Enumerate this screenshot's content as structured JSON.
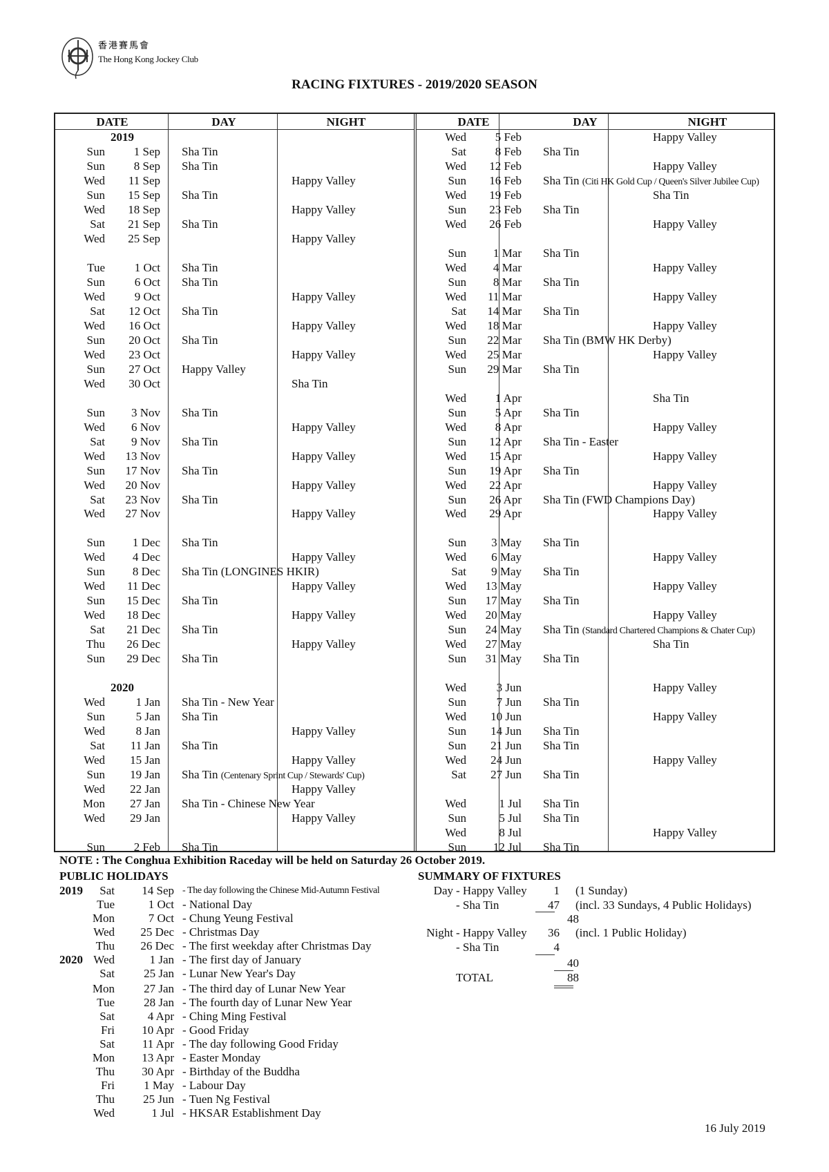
{
  "header": {
    "org_name_cn": "香港賽馬會",
    "org_name_en": "The Hong Kong Jockey Club",
    "logo_icon": "hkjc-crest-icon",
    "title": "RACING FIXTURES - 2019/2020 SEASON"
  },
  "table": {
    "columns": [
      "DATE",
      "DAY",
      "NIGHT",
      "DATE",
      "DAY",
      "NIGHT"
    ],
    "left": [
      {
        "year": "2019"
      },
      {
        "wd": "Sun",
        "date": "1 Sep",
        "day": "Sha Tin"
      },
      {
        "wd": "Sun",
        "date": "8 Sep",
        "day": "Sha Tin"
      },
      {
        "wd": "Wed",
        "date": "11 Sep",
        "night": "Happy Valley"
      },
      {
        "wd": "Sun",
        "date": "15 Sep",
        "day": "Sha Tin"
      },
      {
        "wd": "Wed",
        "date": "18 Sep",
        "night": "Happy Valley"
      },
      {
        "wd": "Sat",
        "date": "21 Sep",
        "day": "Sha Tin"
      },
      {
        "wd": "Wed",
        "date": "25 Sep",
        "night": "Happy Valley"
      },
      {},
      {
        "wd": "Tue",
        "date": "1 Oct",
        "day": "Sha Tin"
      },
      {
        "wd": "Sun",
        "date": "6 Oct",
        "day": "Sha Tin"
      },
      {
        "wd": "Wed",
        "date": "9 Oct",
        "night": "Happy Valley"
      },
      {
        "wd": "Sat",
        "date": "12 Oct",
        "day": "Sha Tin"
      },
      {
        "wd": "Wed",
        "date": "16 Oct",
        "night": "Happy Valley"
      },
      {
        "wd": "Sun",
        "date": "20 Oct",
        "day": "Sha Tin"
      },
      {
        "wd": "Wed",
        "date": "23 Oct",
        "night": "Happy Valley"
      },
      {
        "wd": "Sun",
        "date": "27 Oct",
        "day": "Happy Valley"
      },
      {
        "wd": "Wed",
        "date": "30 Oct",
        "night": "Sha Tin"
      },
      {},
      {
        "wd": "Sun",
        "date": "3 Nov",
        "day": "Sha Tin"
      },
      {
        "wd": "Wed",
        "date": "6 Nov",
        "night": "Happy Valley"
      },
      {
        "wd": "Sat",
        "date": "9 Nov",
        "day": "Sha Tin"
      },
      {
        "wd": "Wed",
        "date": "13 Nov",
        "night": "Happy Valley"
      },
      {
        "wd": "Sun",
        "date": "17 Nov",
        "day": "Sha Tin"
      },
      {
        "wd": "Wed",
        "date": "20 Nov",
        "night": "Happy Valley"
      },
      {
        "wd": "Sat",
        "date": "23 Nov",
        "day": "Sha Tin"
      },
      {
        "wd": "Wed",
        "date": "27 Nov",
        "night": "Happy Valley"
      },
      {},
      {
        "wd": "Sun",
        "date": "1 Dec",
        "day": "Sha Tin"
      },
      {
        "wd": "Wed",
        "date": "4 Dec",
        "night": "Happy Valley"
      },
      {
        "wd": "Sun",
        "date": "8 Dec",
        "day": "Sha Tin (LONGINES HKIR)"
      },
      {
        "wd": "Wed",
        "date": "11 Dec",
        "night": "Happy Valley"
      },
      {
        "wd": "Sun",
        "date": "15 Dec",
        "day": "Sha Tin"
      },
      {
        "wd": "Wed",
        "date": "18 Dec",
        "night": "Happy Valley"
      },
      {
        "wd": "Sat",
        "date": "21 Dec",
        "day": "Sha Tin"
      },
      {
        "wd": "Thu",
        "date": "26 Dec",
        "night": "Happy Valley"
      },
      {
        "wd": "Sun",
        "date": "29 Dec",
        "day": "Sha Tin"
      },
      {},
      {
        "year": "2020"
      },
      {
        "wd": "Wed",
        "date": "1 Jan",
        "day": "Sha Tin - New Year"
      },
      {
        "wd": "Sun",
        "date": "5 Jan",
        "day": "Sha Tin"
      },
      {
        "wd": "Wed",
        "date": "8 Jan",
        "night": "Happy Valley"
      },
      {
        "wd": "Sat",
        "date": "11 Jan",
        "day": "Sha Tin"
      },
      {
        "wd": "Wed",
        "date": "15 Jan",
        "night": "Happy Valley"
      },
      {
        "wd": "Sun",
        "date": "19 Jan",
        "day": "Sha Tin",
        "day_note": "(Centenary Sprint Cup / Stewards' Cup)"
      },
      {
        "wd": "Wed",
        "date": "22 Jan",
        "night": "Happy Valley"
      },
      {
        "wd": "Mon",
        "date": "27 Jan",
        "day": "Sha Tin - Chinese New Year"
      },
      {
        "wd": "Wed",
        "date": "29 Jan",
        "night": "Happy Valley"
      },
      {},
      {
        "wd": "Sun",
        "date": "2 Feb",
        "day": "Sha Tin"
      }
    ],
    "right": [
      {
        "wd": "Wed",
        "date": "5 Feb",
        "night": "Happy Valley"
      },
      {
        "wd": "Sat",
        "date": "8 Feb",
        "day": "Sha Tin"
      },
      {
        "wd": "Wed",
        "date": "12 Feb",
        "night": "Happy Valley"
      },
      {
        "wd": "Sun",
        "date": "16 Feb",
        "day": "Sha Tin",
        "day_note": "(Citi HK Gold Cup / Queen's Silver Jubilee Cup)"
      },
      {
        "wd": "Wed",
        "date": "19 Feb",
        "night": "Sha Tin"
      },
      {
        "wd": "Sun",
        "date": "23 Feb",
        "day": "Sha Tin"
      },
      {
        "wd": "Wed",
        "date": "26 Feb",
        "night": "Happy Valley"
      },
      {},
      {
        "wd": "Sun",
        "date": "1 Mar",
        "day": "Sha Tin"
      },
      {
        "wd": "Wed",
        "date": "4 Mar",
        "night": "Happy Valley"
      },
      {
        "wd": "Sun",
        "date": "8 Mar",
        "day": "Sha Tin"
      },
      {
        "wd": "Wed",
        "date": "11 Mar",
        "night": "Happy Valley"
      },
      {
        "wd": "Sat",
        "date": "14 Mar",
        "day": "Sha Tin"
      },
      {
        "wd": "Wed",
        "date": "18 Mar",
        "night": "Happy Valley"
      },
      {
        "wd": "Sun",
        "date": "22 Mar",
        "day": "Sha Tin (BMW HK Derby)"
      },
      {
        "wd": "Wed",
        "date": "25 Mar",
        "night": "Happy Valley"
      },
      {
        "wd": "Sun",
        "date": "29 Mar",
        "day": "Sha Tin"
      },
      {},
      {
        "wd": "Wed",
        "date": "1 Apr",
        "night": "Sha Tin"
      },
      {
        "wd": "Sun",
        "date": "5 Apr",
        "day": "Sha Tin"
      },
      {
        "wd": "Wed",
        "date": "8 Apr",
        "night": "Happy Valley"
      },
      {
        "wd": "Sun",
        "date": "12 Apr",
        "day": "Sha Tin - Easter"
      },
      {
        "wd": "Wed",
        "date": "15 Apr",
        "night": "Happy Valley"
      },
      {
        "wd": "Sun",
        "date": "19 Apr",
        "day": "Sha Tin"
      },
      {
        "wd": "Wed",
        "date": "22 Apr",
        "night": "Happy Valley"
      },
      {
        "wd": "Sun",
        "date": "26 Apr",
        "day": "Sha Tin (FWD Champions Day)"
      },
      {
        "wd": "Wed",
        "date": "29 Apr",
        "night": "Happy Valley"
      },
      {},
      {
        "wd": "Sun",
        "date": "3 May",
        "day": "Sha Tin"
      },
      {
        "wd": "Wed",
        "date": "6 May",
        "night": "Happy Valley"
      },
      {
        "wd": "Sat",
        "date": "9 May",
        "day": "Sha Tin"
      },
      {
        "wd": "Wed",
        "date": "13 May",
        "night": "Happy Valley"
      },
      {
        "wd": "Sun",
        "date": "17 May",
        "day": "Sha Tin"
      },
      {
        "wd": "Wed",
        "date": "20 May",
        "night": "Happy Valley"
      },
      {
        "wd": "Sun",
        "date": "24 May",
        "day": "Sha Tin",
        "day_note": "(Standard Chartered Champions & Chater Cup)"
      },
      {
        "wd": "Wed",
        "date": "27 May",
        "night": "Sha Tin"
      },
      {
        "wd": "Sun",
        "date": "31 May",
        "day": "Sha Tin"
      },
      {},
      {
        "wd": "Wed",
        "date": "3 Jun",
        "night": "Happy Valley"
      },
      {
        "wd": "Sun",
        "date": "7 Jun",
        "day": "Sha Tin"
      },
      {
        "wd": "Wed",
        "date": "10 Jun",
        "night": "Happy Valley"
      },
      {
        "wd": "Sun",
        "date": "14 Jun",
        "day": "Sha Tin"
      },
      {
        "wd": "Sun",
        "date": "21 Jun",
        "day": "Sha Tin"
      },
      {
        "wd": "Wed",
        "date": "24 Jun",
        "night": "Happy Valley"
      },
      {
        "wd": "Sat",
        "date": "27 Jun",
        "day": "Sha Tin"
      },
      {},
      {
        "wd": "Wed",
        "date": "1 Jul",
        "day": "Sha Tin"
      },
      {
        "wd": "Sun",
        "date": "5 Jul",
        "day": "Sha Tin"
      },
      {
        "wd": "Wed",
        "date": "8 Jul",
        "night": "Happy Valley"
      },
      {
        "wd": "Sun",
        "date": "12 Jul",
        "day": "Sha Tin"
      }
    ]
  },
  "note": "NOTE : The Conghua Exhibition Raceday will be held on Saturday 26 October 2019.",
  "public_holidays": {
    "title": "PUBLIC HOLIDAYS",
    "items": [
      {
        "year": "2019",
        "wd": "Sat",
        "date": "14 Sep",
        "name": "- The day following the Chinese Mid-Autumn Festival",
        "condensed": true
      },
      {
        "wd": "Tue",
        "date": "1 Oct",
        "name": "- National Day"
      },
      {
        "wd": "Mon",
        "date": "7 Oct",
        "name": "- Chung Yeung Festival"
      },
      {
        "wd": "Wed",
        "date": "25 Dec",
        "name": "- Christmas Day"
      },
      {
        "wd": "Thu",
        "date": "26 Dec",
        "name": "- The first weekday after Christmas Day"
      },
      {
        "year": "2020",
        "wd": "Wed",
        "date": "1 Jan",
        "name": "- The first day of January"
      },
      {
        "wd": "Sat",
        "date": "25 Jan",
        "name": "- Lunar New Year's Day"
      },
      {
        "wd": "Mon",
        "date": "27 Jan",
        "name": "- The third day of Lunar New Year"
      },
      {
        "wd": "Tue",
        "date": "28 Jan",
        "name": "- The fourth day of Lunar New Year"
      },
      {
        "wd": "Sat",
        "date": "4 Apr",
        "name": "- Ching Ming Festival"
      },
      {
        "wd": "Fri",
        "date": "10 Apr",
        "name": "- Good Friday"
      },
      {
        "wd": "Sat",
        "date": "11 Apr",
        "name": "- The day following Good Friday"
      },
      {
        "wd": "Mon",
        "date": "13 Apr",
        "name": "- Easter Monday"
      },
      {
        "wd": "Thu",
        "date": "30 Apr",
        "name": "- Birthday of the Buddha"
      },
      {
        "wd": "Fri",
        "date": "1 May",
        "name": "- Labour Day"
      },
      {
        "wd": "Thu",
        "date": "25 Jun",
        "name": "- Tuen Ng Festival"
      },
      {
        "wd": "Wed",
        "date": "1 Jul",
        "name": "- HKSAR Establishment Day"
      }
    ]
  },
  "summary": {
    "title": "SUMMARY OF FIXTURES",
    "day_label": "Day",
    "night_label": "Night",
    "day_hv": {
      "venue": "- Happy Valley",
      "count": "1",
      "comment": "(1 Sunday)"
    },
    "day_st": {
      "venue": "- Sha Tin",
      "count": "47",
      "comment": "(incl. 33 Sundays, 4 Public Holidays)"
    },
    "day_subtotal": "48",
    "night_hv": {
      "venue": "- Happy Valley",
      "count": "36",
      "comment": "(incl. 1 Public Holiday)"
    },
    "night_st": {
      "venue": "- Sha Tin",
      "count": "4"
    },
    "night_subtotal": "40",
    "total_label": "TOTAL",
    "total": "88"
  },
  "issued_date": "16 July 2019"
}
